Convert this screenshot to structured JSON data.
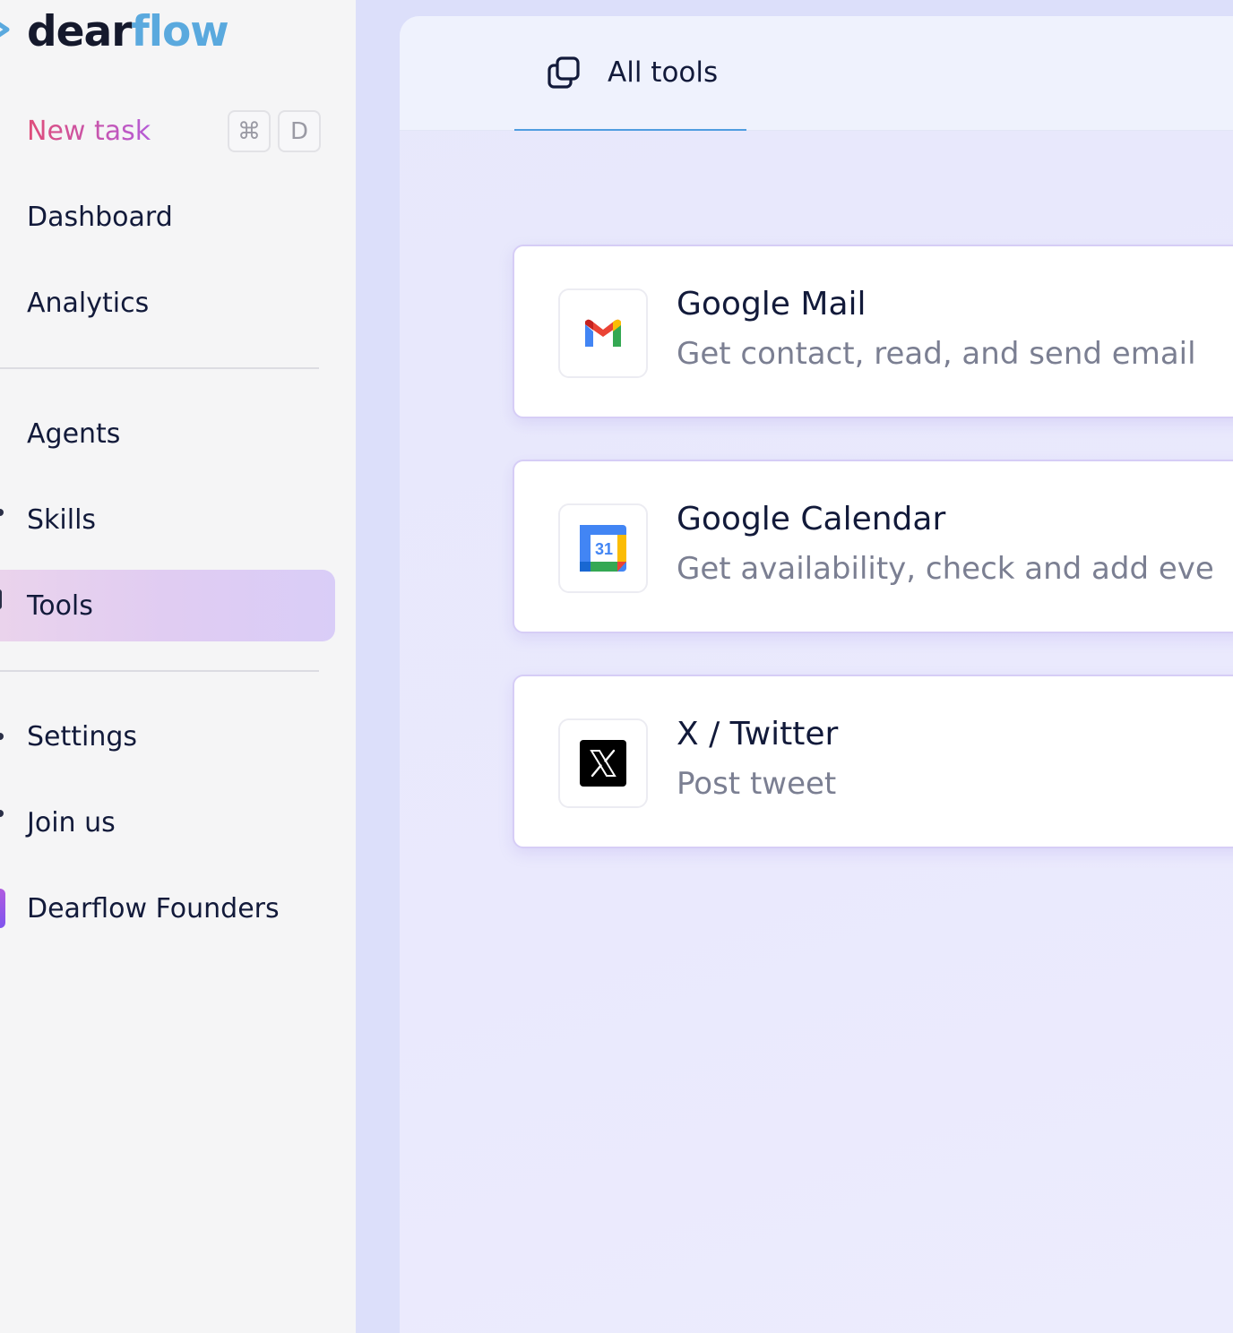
{
  "brand": {
    "name_part1": "dear",
    "name_part2": "flow"
  },
  "sidebar": {
    "new_task": {
      "label": "New task",
      "shortcut_cmd": "⌘",
      "shortcut_key": "D"
    },
    "items": [
      {
        "label": "Dashboard"
      },
      {
        "label": "Analytics"
      },
      {
        "label": "Agents"
      },
      {
        "label": "Skills"
      },
      {
        "label": "Tools",
        "active": true
      },
      {
        "label": "Settings"
      },
      {
        "label": "Join us"
      },
      {
        "label": "Dearflow Founders"
      }
    ]
  },
  "main": {
    "tabs": [
      {
        "label": "All tools",
        "icon": "copy-icon",
        "active": true
      }
    ],
    "tools": [
      {
        "title": "Google Mail",
        "description": "Get contact, read, and send email",
        "icon": "gmail-icon"
      },
      {
        "title": "Google Calendar",
        "description": "Get availability, check and add eve",
        "icon": "google-calendar-icon",
        "icon_text": "31"
      },
      {
        "title": "X / Twitter",
        "description": "Post tweet",
        "icon": "x-twitter-icon"
      }
    ]
  },
  "colors": {
    "accent_blue": "#5aa9de",
    "new_task_gradient_start": "#df4d79",
    "new_task_gradient_end": "#b55bd7",
    "active_item_bg": "#e0ccf2"
  }
}
